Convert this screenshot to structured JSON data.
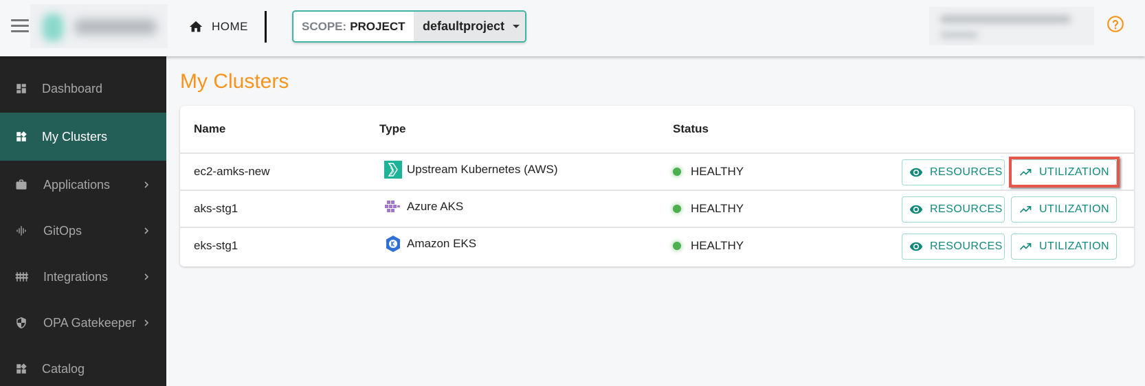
{
  "header": {
    "menu_icon": "hamburger-menu-icon",
    "logo_alt": "blurred-logo",
    "home_label": "HOME",
    "home_icon": "home-icon",
    "scope": {
      "prefix": "SCOPE:",
      "type": "PROJECT",
      "selected_project": "defaultproject",
      "dropdown_icon": "caret-down-icon"
    },
    "help_icon": "help-circle-icon"
  },
  "sidebar": {
    "items": [
      {
        "label": "Dashboard",
        "icon": "dashboard-icon",
        "active": false,
        "has_submenu": false
      },
      {
        "label": "My Clusters",
        "icon": "widgets-icon",
        "active": true,
        "has_submenu": false
      },
      {
        "label": "Applications",
        "icon": "briefcase-icon",
        "active": false,
        "has_submenu": true
      },
      {
        "label": "GitOps",
        "icon": "waveform-icon",
        "active": false,
        "has_submenu": true
      },
      {
        "label": "Integrations",
        "icon": "sliders-icon",
        "active": false,
        "has_submenu": true
      },
      {
        "label": "OPA Gatekeeper",
        "icon": "shield-icon",
        "active": false,
        "has_submenu": true
      },
      {
        "label": "Catalog",
        "icon": "widgets-icon",
        "active": false,
        "has_submenu": false
      }
    ]
  },
  "main": {
    "title": "My Clusters",
    "table": {
      "columns": [
        "Name",
        "Type",
        "Status"
      ],
      "rows": [
        {
          "name": "ec2-amks-new",
          "type": "Upstream Kubernetes (AWS)",
          "type_icon": "upstream-kubernetes-icon",
          "status": "HEALTHY",
          "resources_label": "RESOURCES",
          "utilization_label": "UTILIZATION",
          "utilization_highlighted": true
        },
        {
          "name": "aks-stg1",
          "type": "Azure AKS",
          "type_icon": "azure-aks-icon",
          "status": "HEALTHY",
          "resources_label": "RESOURCES",
          "utilization_label": "UTILIZATION",
          "utilization_highlighted": false
        },
        {
          "name": "eks-stg1",
          "type": "Amazon EKS",
          "type_icon": "amazon-eks-icon",
          "status": "HEALTHY",
          "resources_label": "RESOURCES",
          "utilization_label": "UTILIZATION",
          "utilization_highlighted": false
        }
      ]
    }
  },
  "colors": {
    "accent_teal": "#12897b",
    "title_orange": "#f7941d",
    "sidebar_bg": "#232323",
    "sidebar_active": "#235e57",
    "status_healthy": "#4caf50",
    "highlight_red": "#e5574a"
  }
}
